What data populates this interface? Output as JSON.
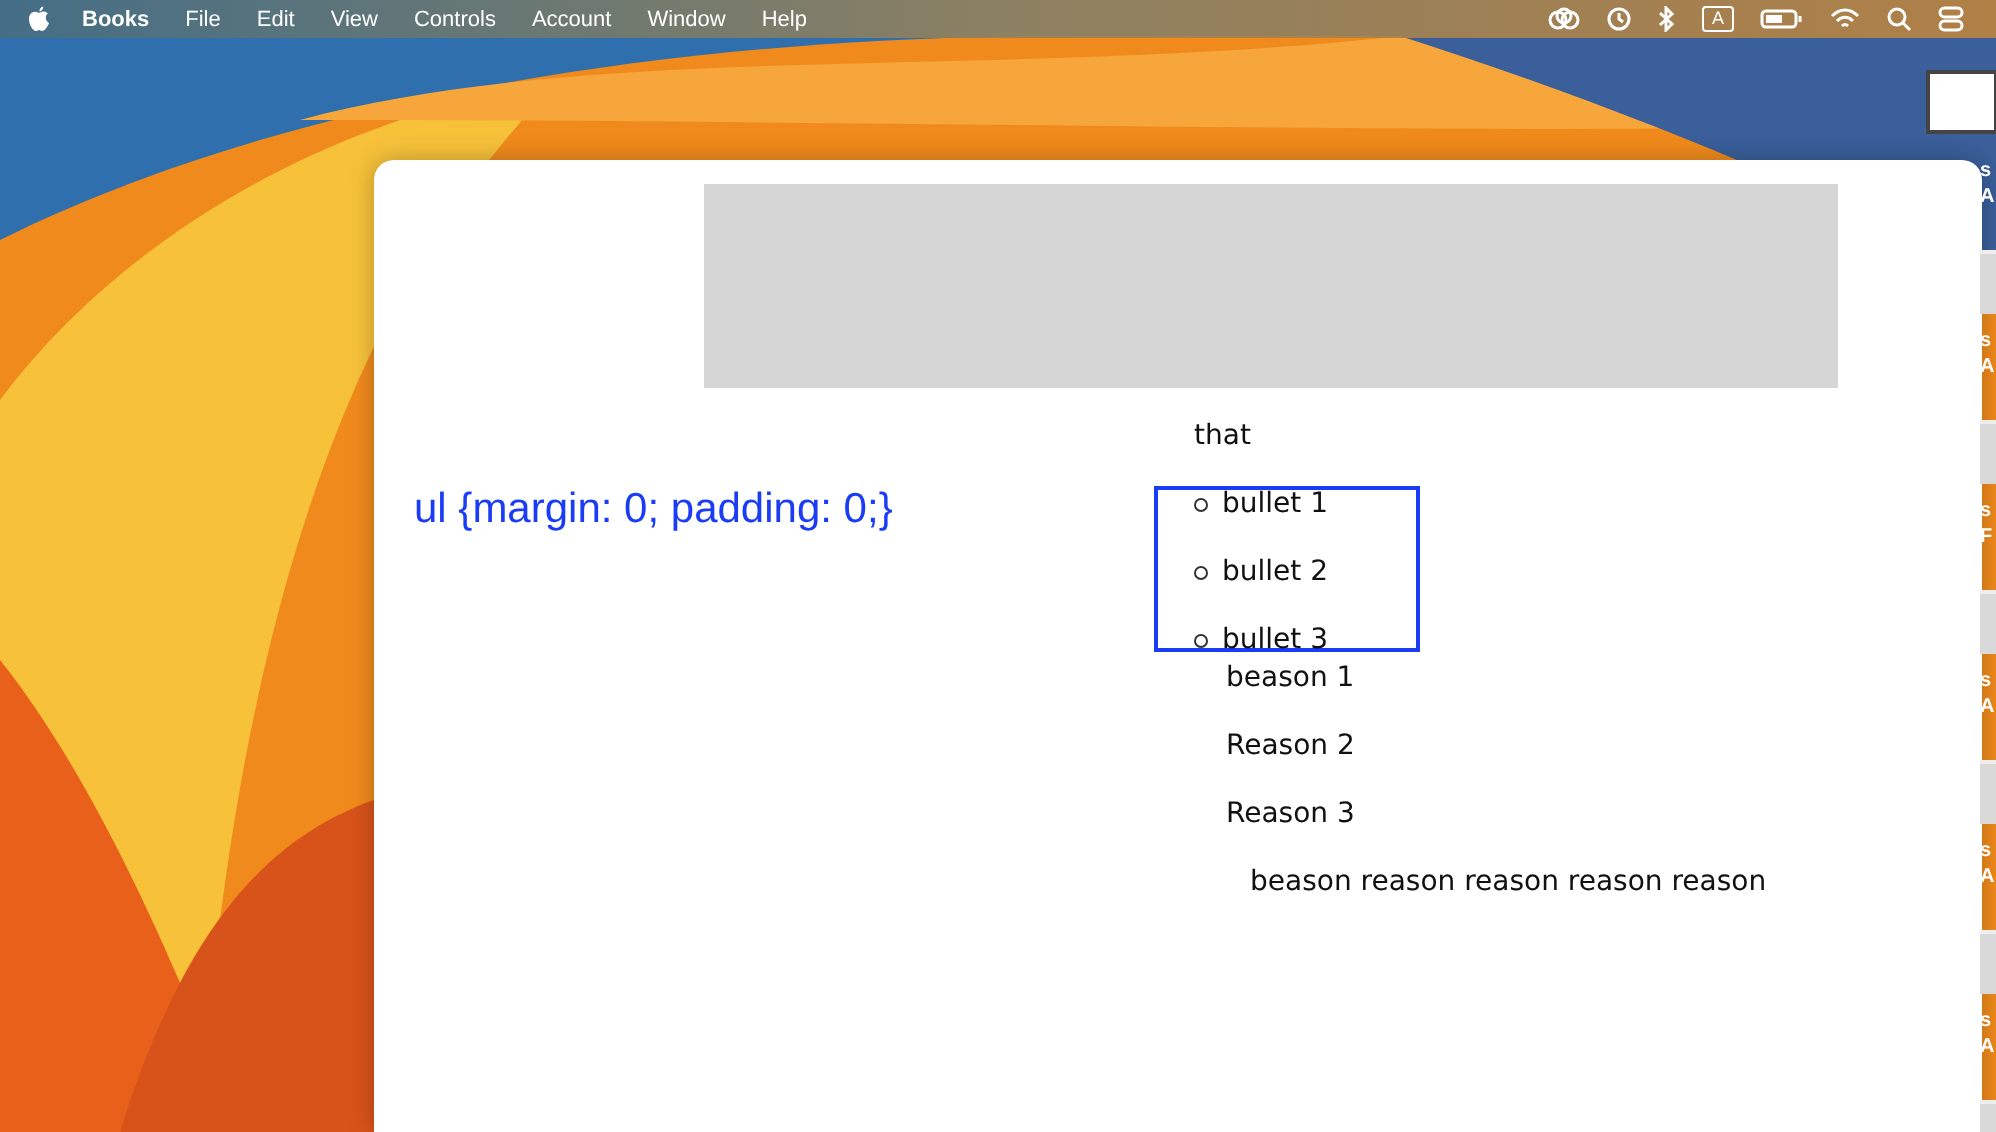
{
  "menu_bar": {
    "app": "Books",
    "menus": [
      "File",
      "Edit",
      "View",
      "Controls",
      "Account",
      "Window",
      "Help"
    ],
    "input_source": "A"
  },
  "window": {
    "note": "ul {margin: 0; padding: 0;}",
    "heading": "that",
    "bullets": [
      "bullet 1",
      "bullet 2",
      "bullet 3"
    ],
    "reasons": [
      "beason 1",
      "Reason 2",
      "Reason 3"
    ],
    "paragraph": "beason reason reason reason reason"
  },
  "desktop_files": [
    {
      "line_1": "s",
      "line_2": "A"
    },
    {
      "line_1": "s",
      "line_2": "A"
    },
    {
      "line_1": "s",
      "line_2": "F"
    },
    {
      "line_1": "s",
      "line_2": "A"
    },
    {
      "line_1": "s",
      "line_2": "A"
    },
    {
      "line_1": "s",
      "line_2": "A"
    }
  ]
}
